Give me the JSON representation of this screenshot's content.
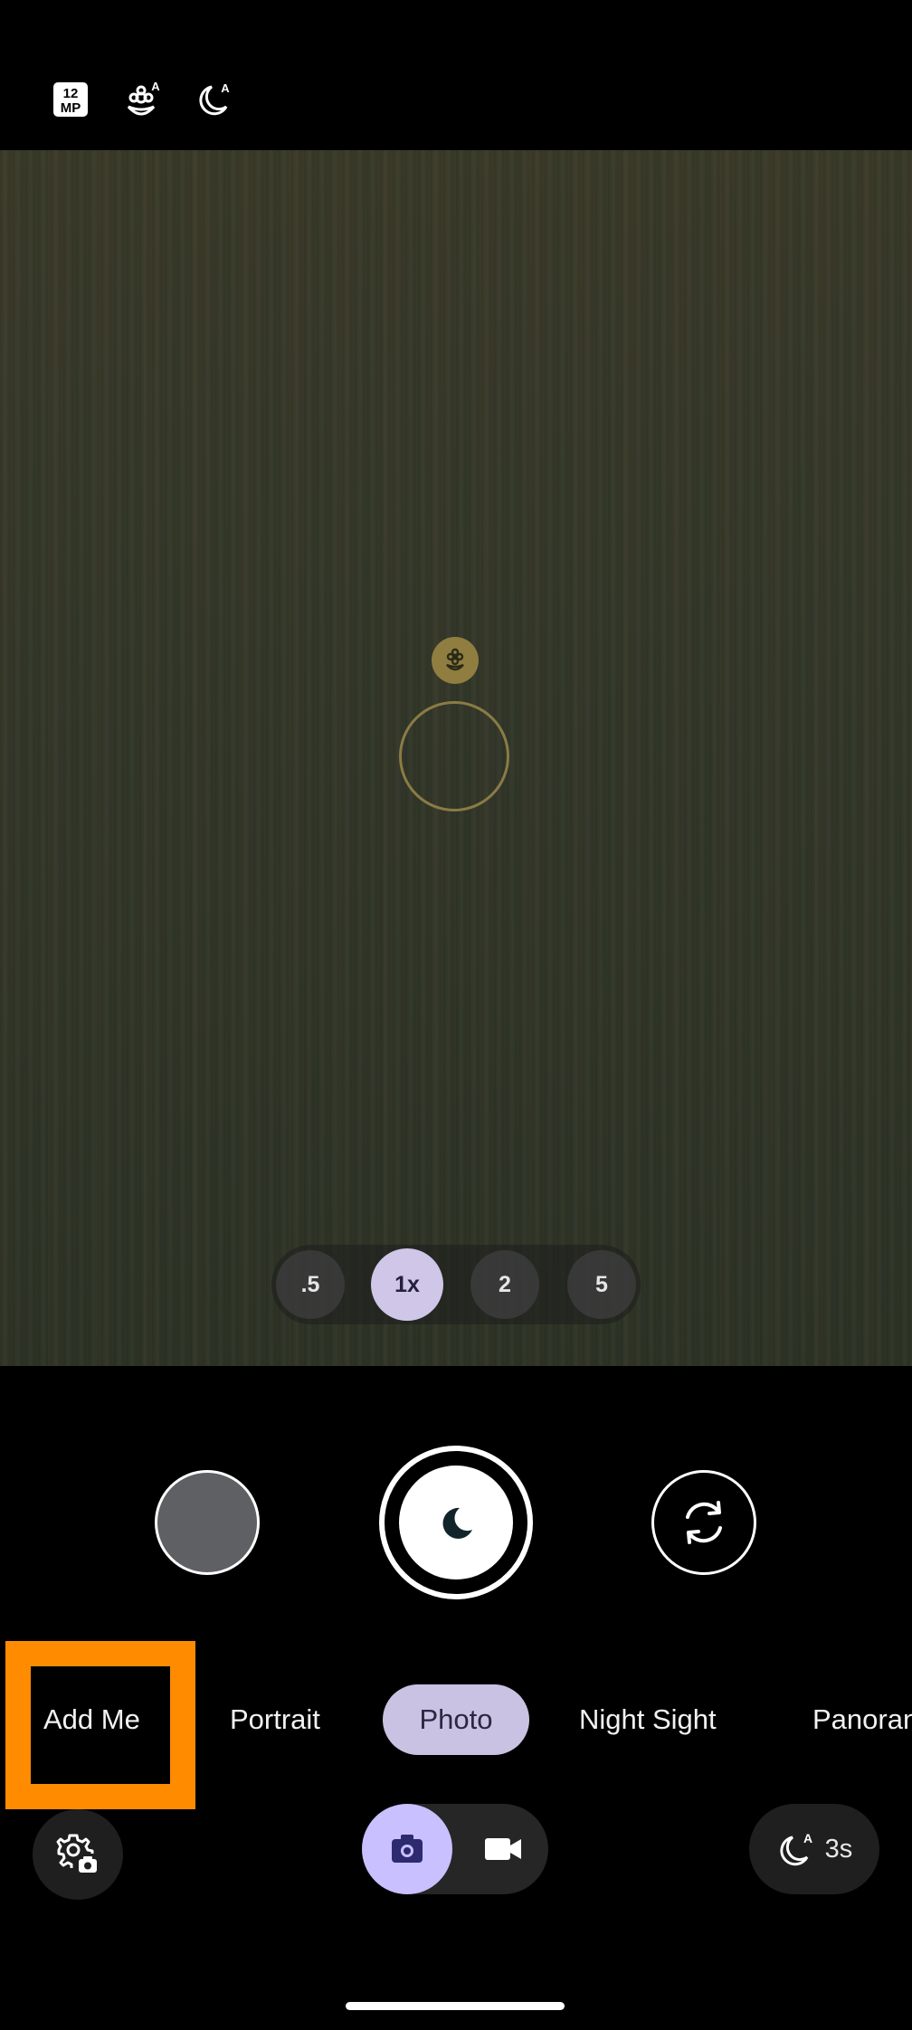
{
  "top_bar": {
    "resolution_badge": {
      "icon": "12mp-icon",
      "label": "12\nMP"
    },
    "macro_auto": {
      "icon": "macro-auto-icon",
      "label": "A"
    },
    "night_auto": {
      "icon": "night-auto-icon",
      "label": "A"
    }
  },
  "zoom": {
    "options": [
      ".5",
      "1x",
      "2",
      "5"
    ],
    "selected": "1x"
  },
  "capture": {
    "gallery_icon": "gallery-thumbnail",
    "shutter_icon": "moon-icon",
    "flip_icon": "switch-camera-icon"
  },
  "modes": {
    "items": [
      "Add Me",
      "Portrait",
      "Photo",
      "Night Sight",
      "Panoran"
    ],
    "selected": "Photo"
  },
  "bottom": {
    "settings_icon": "camera-settings-icon",
    "photo_icon": "camera-icon",
    "video_icon": "video-icon",
    "night_badge": "A",
    "timer": "3s"
  },
  "colors": {
    "highlight": "#ff8c00",
    "accent": "#c8c0ff",
    "mode_pill": "#c9c2e2",
    "focus_ring": "#8a7b45"
  }
}
